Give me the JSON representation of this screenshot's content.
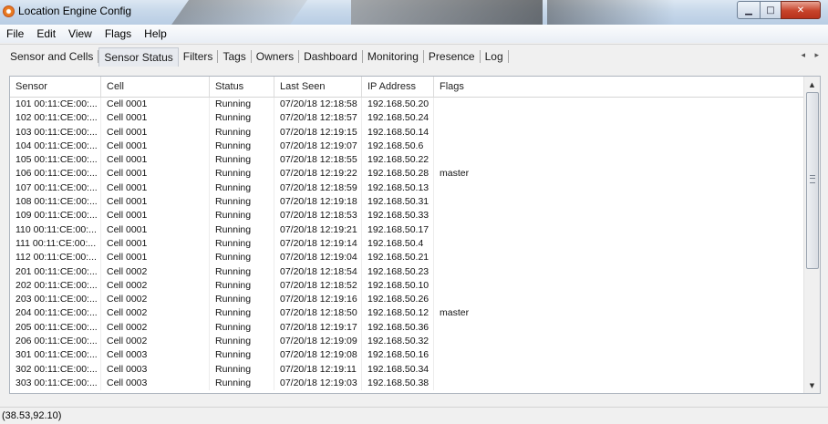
{
  "window": {
    "title": "Location Engine Config"
  },
  "menu": [
    "File",
    "Edit",
    "View",
    "Flags",
    "Help"
  ],
  "tabs": [
    {
      "label": "Sensor and Cells",
      "active": false
    },
    {
      "label": "Sensor Status",
      "active": true
    },
    {
      "label": "Filters",
      "active": false
    },
    {
      "label": "Tags",
      "active": false
    },
    {
      "label": "Owners",
      "active": false
    },
    {
      "label": "Dashboard",
      "active": false
    },
    {
      "label": "Monitoring",
      "active": false
    },
    {
      "label": "Presence",
      "active": false
    },
    {
      "label": "Log",
      "active": false
    }
  ],
  "tab_arrows": "◂ ▸",
  "grid": {
    "columns": [
      "Sensor",
      "Cell",
      "Status",
      "Last Seen",
      "IP Address",
      "Flags"
    ],
    "rows": [
      [
        "101 00:11:CE:00:...",
        "Cell 0001",
        "Running",
        "07/20/18 12:18:58",
        "192.168.50.20",
        ""
      ],
      [
        "102 00:11:CE:00:...",
        "Cell 0001",
        "Running",
        "07/20/18 12:18:57",
        "192.168.50.24",
        ""
      ],
      [
        "103 00:11:CE:00:...",
        "Cell 0001",
        "Running",
        "07/20/18 12:19:15",
        "192.168.50.14",
        ""
      ],
      [
        "104 00:11:CE:00:...",
        "Cell 0001",
        "Running",
        "07/20/18 12:19:07",
        "192.168.50.6",
        ""
      ],
      [
        "105 00:11:CE:00:...",
        "Cell 0001",
        "Running",
        "07/20/18 12:18:55",
        "192.168.50.22",
        ""
      ],
      [
        "106 00:11:CE:00:...",
        "Cell 0001",
        "Running",
        "07/20/18 12:19:22",
        "192.168.50.28",
        "master"
      ],
      [
        "107 00:11:CE:00:...",
        "Cell 0001",
        "Running",
        "07/20/18 12:18:59",
        "192.168.50.13",
        ""
      ],
      [
        "108 00:11:CE:00:...",
        "Cell 0001",
        "Running",
        "07/20/18 12:19:18",
        "192.168.50.31",
        ""
      ],
      [
        "109 00:11:CE:00:...",
        "Cell 0001",
        "Running",
        "07/20/18 12:18:53",
        "192.168.50.33",
        ""
      ],
      [
        "110 00:11:CE:00:...",
        "Cell 0001",
        "Running",
        "07/20/18 12:19:21",
        "192.168.50.17",
        ""
      ],
      [
        "111 00:11:CE:00:...",
        "Cell 0001",
        "Running",
        "07/20/18 12:19:14",
        "192.168.50.4",
        ""
      ],
      [
        "112 00:11:CE:00:...",
        "Cell 0001",
        "Running",
        "07/20/18 12:19:04",
        "192.168.50.21",
        ""
      ],
      [
        "201 00:11:CE:00:...",
        "Cell 0002",
        "Running",
        "07/20/18 12:18:54",
        "192.168.50.23",
        ""
      ],
      [
        "202 00:11:CE:00:...",
        "Cell 0002",
        "Running",
        "07/20/18 12:18:52",
        "192.168.50.10",
        ""
      ],
      [
        "203 00:11:CE:00:...",
        "Cell 0002",
        "Running",
        "07/20/18 12:19:16",
        "192.168.50.26",
        ""
      ],
      [
        "204 00:11:CE:00:...",
        "Cell 0002",
        "Running",
        "07/20/18 12:18:50",
        "192.168.50.12",
        "master"
      ],
      [
        "205 00:11:CE:00:...",
        "Cell 0002",
        "Running",
        "07/20/18 12:19:17",
        "192.168.50.36",
        ""
      ],
      [
        "206 00:11:CE:00:...",
        "Cell 0002",
        "Running",
        "07/20/18 12:19:09",
        "192.168.50.32",
        ""
      ],
      [
        "301 00:11:CE:00:...",
        "Cell 0003",
        "Running",
        "07/20/18 12:19:08",
        "192.168.50.16",
        ""
      ],
      [
        "302 00:11:CE:00:...",
        "Cell 0003",
        "Running",
        "07/20/18 12:19:11",
        "192.168.50.34",
        ""
      ],
      [
        "303 00:11:CE:00:...",
        "Cell 0003",
        "Running",
        "07/20/18 12:19:03",
        "192.168.50.38",
        ""
      ]
    ]
  },
  "status_bar": {
    "text": "(38.53,92.10)"
  }
}
